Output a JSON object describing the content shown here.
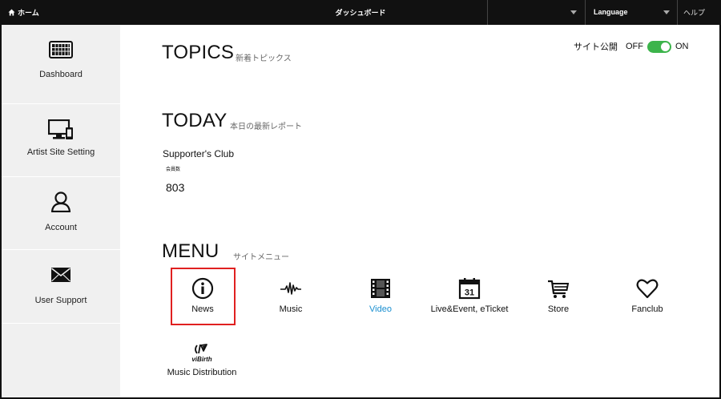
{
  "topbar": {
    "home_label": "ホーム",
    "title": "ダッシュボード",
    "language_label": "Language",
    "help_label": "ヘルプ"
  },
  "sidebar": {
    "items": [
      {
        "label": "Dashboard",
        "icon": "keyboard-icon"
      },
      {
        "label": "Artist Site Setting",
        "icon": "monitor-icon"
      },
      {
        "label": "Account",
        "icon": "user-icon"
      },
      {
        "label": "User Support",
        "icon": "envelope-icon"
      }
    ]
  },
  "topics": {
    "title": "TOPICS",
    "subtitle": "新着トピックス",
    "site_public_label": "サイト公開",
    "off_label": "OFF",
    "on_label": "ON",
    "toggle_state": "on",
    "toggle_color": "#3cb44b"
  },
  "today": {
    "title": "TODAY",
    "subtitle": "本日の最新レポート",
    "club_name": "Supporter's Club",
    "member_label": "会員数",
    "member_count": "803"
  },
  "menu": {
    "title": "MENU",
    "subtitle": "サイトメニュー",
    "items": [
      {
        "label": "News",
        "icon": "info-icon",
        "highlighted": true
      },
      {
        "label": "Music",
        "icon": "waveform-icon"
      },
      {
        "label": "Video",
        "icon": "film-icon",
        "active": true
      },
      {
        "label": "Live&Event, eTicket",
        "icon": "calendar-icon",
        "calendar_day": "31"
      },
      {
        "label": "Store",
        "icon": "cart-icon"
      },
      {
        "label": "Fanclub",
        "icon": "heart-icon"
      },
      {
        "label": "Music Distribution",
        "icon": "vibirth-icon",
        "logo_text": "viBirth"
      }
    ],
    "active_color": "#1a8fd0",
    "highlight_color": "#e02020"
  }
}
